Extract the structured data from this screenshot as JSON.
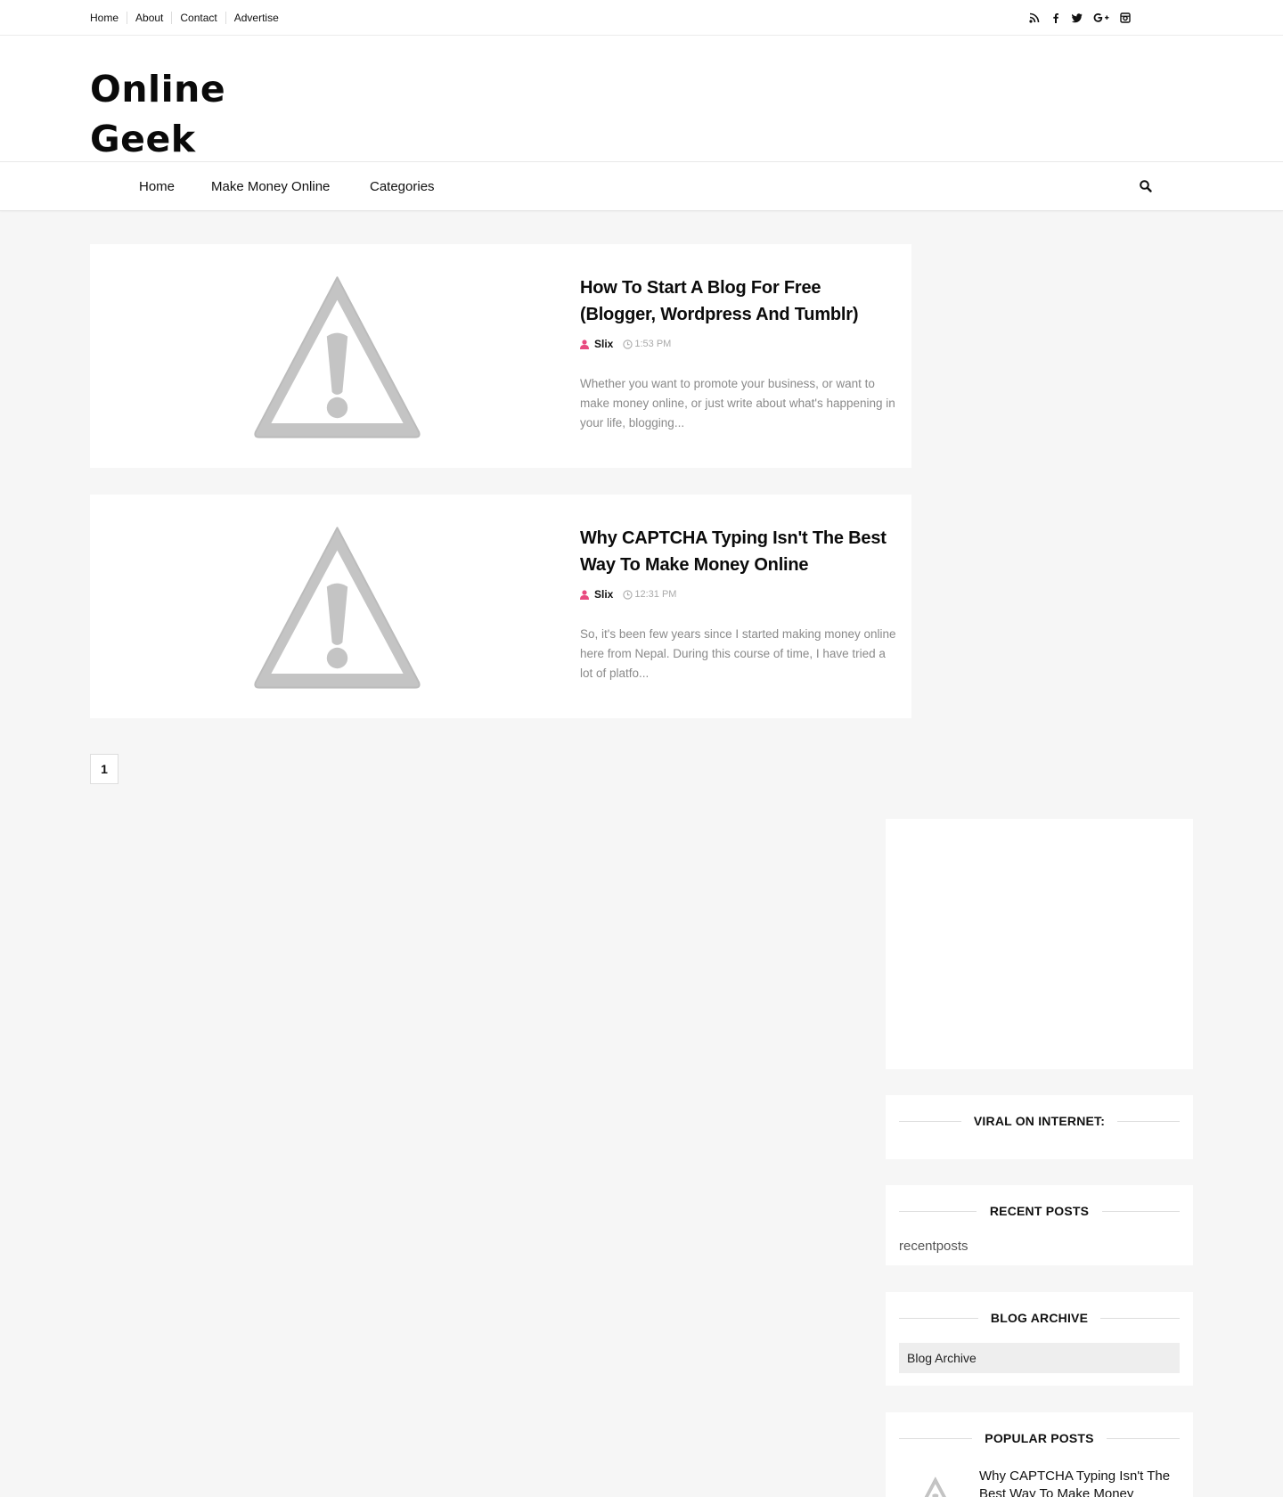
{
  "topbar": {
    "links": [
      "Home",
      "About",
      "Contact",
      "Advertise"
    ],
    "social_icons": [
      "rss-icon",
      "facebook-icon",
      "twitter-icon",
      "google-plus-icon",
      "instagram-icon"
    ]
  },
  "header": {
    "logo_line1": "Online",
    "logo_line2": "Geek"
  },
  "nav": {
    "items": [
      "Home",
      "Make Money Online",
      "Categories"
    ],
    "search_icon": "search-icon"
  },
  "posts": [
    {
      "title": "How To Start A Blog For Free (Blogger, Wordpress And Tumblr)",
      "author": "Slix",
      "time": "1:53 PM",
      "excerpt": "Whether you want to promote your business, or want to make money online, or just write about what's happening in your life, blogging..."
    },
    {
      "title": "Why CAPTCHA Typing Isn't The Best Way To Make Money Online",
      "author": "Slix",
      "time": "12:31 PM",
      "excerpt": "So, it's been few years since I started making money online here from Nepal. During this course of time, I have tried a lot of platfo..."
    }
  ],
  "pagination": {
    "current": "1"
  },
  "sidebar": {
    "viral_title": "VIRAL ON INTERNET:",
    "recent_title": "RECENT POSTS",
    "recent_text": "recentposts",
    "archive_title": "BLOG ARCHIVE",
    "archive_select": "Blog Archive",
    "popular_title": "POPULAR POSTS",
    "popular_first": "Why CAPTCHA Typing Isn't The Best Way To Make Money"
  },
  "colors": {
    "accent": "#e84a7f",
    "muted_text": "#8a8a8a",
    "background": "#f6f6f6"
  }
}
